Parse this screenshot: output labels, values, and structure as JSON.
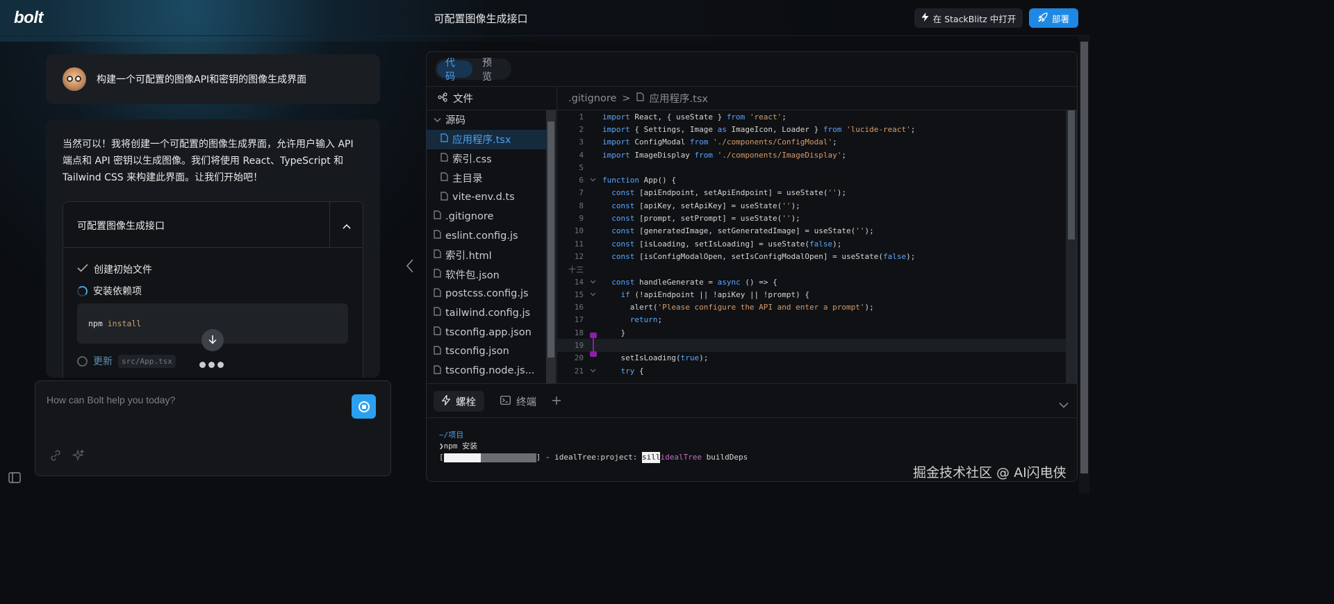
{
  "header": {
    "logo": "bolt",
    "title": "可配置图像生成接口",
    "stackblitz_label": "在 StackBlitz 中打开",
    "deploy_label": "部署"
  },
  "chat": {
    "user_message": "构建一个可配置的图像API和密钥的图像生成界面",
    "ai_message": "当然可以！我将创建一个可配置的图像生成界面，允许用户输入 API 端点和 API 密钥以生成图像。我们将使用 React、TypeScript 和 Tailwind CSS 来构建此界面。让我们开始吧！",
    "artifact": {
      "title": "可配置图像生成接口",
      "steps": [
        {
          "label": "创建初始文件",
          "status": "done"
        },
        {
          "label": "安装依赖项",
          "status": "running"
        },
        {
          "label": "更新",
          "chip": "src/App.tsx",
          "status": "pending"
        }
      ],
      "command": {
        "cmd": "npm",
        "arg": "install"
      }
    }
  },
  "prompt": {
    "placeholder": "How can Bolt help you today?"
  },
  "workbench": {
    "tabs": [
      "代码",
      "预览"
    ],
    "active_tab": "代码",
    "files_label": "文件",
    "tree": [
      {
        "name": "源码",
        "type": "folder",
        "depth": 0
      },
      {
        "name": "应用程序.tsx",
        "type": "file",
        "depth": 1,
        "selected": true
      },
      {
        "name": "索引.css",
        "type": "file",
        "depth": 1
      },
      {
        "name": "主目录",
        "type": "file",
        "depth": 1
      },
      {
        "name": "vite-env.d.ts",
        "type": "file",
        "depth": 1
      },
      {
        "name": ".gitignore",
        "type": "file",
        "depth": 0
      },
      {
        "name": "eslint.config.js",
        "type": "file",
        "depth": 0
      },
      {
        "name": "索引.html",
        "type": "file",
        "depth": 0
      },
      {
        "name": "软件包.json",
        "type": "file",
        "depth": 0
      },
      {
        "name": "postcss.config.js",
        "type": "file",
        "depth": 0
      },
      {
        "name": "tailwind.config.js",
        "type": "file",
        "depth": 0
      },
      {
        "name": "tsconfig.app.json",
        "type": "file",
        "depth": 0
      },
      {
        "name": "tsconfig.json",
        "type": "file",
        "depth": 0
      },
      {
        "name": "tsconfig.node.js...",
        "type": "file",
        "depth": 0
      }
    ],
    "breadcrumb": [
      ".gitignore",
      "应用程序.tsx"
    ],
    "code_lines": [
      {
        "n": "1",
        "fold": "",
        "tokens": [
          [
            "kw",
            "import "
          ],
          [
            "id",
            "React, { useState } "
          ],
          [
            "kw",
            "from "
          ],
          [
            "st",
            "'react'"
          ],
          [
            "id",
            ";"
          ]
        ]
      },
      {
        "n": "2",
        "fold": "",
        "tokens": [
          [
            "kw",
            "import "
          ],
          [
            "id",
            "{ Settings, Image "
          ],
          [
            "kw",
            "as "
          ],
          [
            "id",
            "ImageIcon, Loader } "
          ],
          [
            "kw",
            "from "
          ],
          [
            "st",
            "'lucide-react'"
          ],
          [
            "id",
            ";"
          ]
        ]
      },
      {
        "n": "3",
        "fold": "",
        "tokens": [
          [
            "kw",
            "import "
          ],
          [
            "id",
            "ConfigModal "
          ],
          [
            "kw",
            "from "
          ],
          [
            "st",
            "'./components/ConfigModal'"
          ],
          [
            "id",
            ";"
          ]
        ]
      },
      {
        "n": "4",
        "fold": "",
        "tokens": [
          [
            "kw",
            "import "
          ],
          [
            "id",
            "ImageDisplay "
          ],
          [
            "kw",
            "from "
          ],
          [
            "st",
            "'./components/ImageDisplay'"
          ],
          [
            "id",
            ";"
          ]
        ]
      },
      {
        "n": "5",
        "fold": "",
        "tokens": []
      },
      {
        "n": "6",
        "fold": "v",
        "tokens": [
          [
            "kw",
            "function "
          ],
          [
            "id",
            "App() {"
          ]
        ]
      },
      {
        "n": "7",
        "fold": "",
        "tokens": [
          [
            "id",
            "  "
          ],
          [
            "kw",
            "const "
          ],
          [
            "id",
            "[apiEndpoint, setApiEndpoint] = useState("
          ],
          [
            "st",
            "''"
          ],
          [
            "id",
            ");"
          ]
        ]
      },
      {
        "n": "8",
        "fold": "",
        "tokens": [
          [
            "id",
            "  "
          ],
          [
            "kw",
            "const "
          ],
          [
            "id",
            "[apiKey, setApiKey] = useState("
          ],
          [
            "st",
            "''"
          ],
          [
            "id",
            ");"
          ]
        ]
      },
      {
        "n": "9",
        "fold": "",
        "tokens": [
          [
            "id",
            "  "
          ],
          [
            "kw",
            "const "
          ],
          [
            "id",
            "[prompt, setPrompt] = useState("
          ],
          [
            "st",
            "''"
          ],
          [
            "id",
            ");"
          ]
        ]
      },
      {
        "n": "10",
        "fold": "",
        "tokens": [
          [
            "id",
            "  "
          ],
          [
            "kw",
            "const "
          ],
          [
            "id",
            "[generatedImage, setGeneratedImage] = useState("
          ],
          [
            "st",
            "''"
          ],
          [
            "id",
            ");"
          ]
        ]
      },
      {
        "n": "11",
        "fold": "",
        "tokens": [
          [
            "id",
            "  "
          ],
          [
            "kw",
            "const "
          ],
          [
            "id",
            "[isLoading, setIsLoading] = useState("
          ],
          [
            "kw",
            "false"
          ],
          [
            "id",
            ");"
          ]
        ]
      },
      {
        "n": "12",
        "fold": "",
        "tokens": [
          [
            "id",
            "  "
          ],
          [
            "kw",
            "const "
          ],
          [
            "id",
            "[isConfigModalOpen, setIsConfigModalOpen] = useState("
          ],
          [
            "kw",
            "false"
          ],
          [
            "id",
            ");"
          ]
        ]
      },
      {
        "n": "十三",
        "fold": "",
        "tokens": []
      },
      {
        "n": "14",
        "fold": "v",
        "tokens": [
          [
            "id",
            "  "
          ],
          [
            "kw",
            "const "
          ],
          [
            "id",
            "handleGenerate = "
          ],
          [
            "kw",
            "async "
          ],
          [
            "id",
            "() => {"
          ]
        ]
      },
      {
        "n": "15",
        "fold": "v",
        "tokens": [
          [
            "id",
            "    "
          ],
          [
            "kw",
            "if "
          ],
          [
            "id",
            "(!apiEndpoint || !apiKey || !prompt) {"
          ]
        ]
      },
      {
        "n": "16",
        "fold": "",
        "tokens": [
          [
            "id",
            "      alert("
          ],
          [
            "st",
            "'Please configure the API and enter a prompt'"
          ],
          [
            "id",
            ");"
          ]
        ]
      },
      {
        "n": "17",
        "fold": "",
        "tokens": [
          [
            "id",
            "      "
          ],
          [
            "kw",
            "return"
          ],
          [
            "id",
            ";"
          ]
        ]
      },
      {
        "n": "18",
        "fold": "",
        "tokens": [
          [
            "id",
            "    }"
          ]
        ]
      },
      {
        "n": "19",
        "fold": "",
        "tokens": [],
        "highlight": true
      },
      {
        "n": "20",
        "fold": "",
        "tokens": [
          [
            "id",
            "    setIsLoading("
          ],
          [
            "kw",
            "true"
          ],
          [
            "id",
            ");"
          ]
        ]
      },
      {
        "n": "21",
        "fold": "v",
        "tokens": [
          [
            "id",
            "    "
          ],
          [
            "kw",
            "try "
          ],
          [
            "id",
            "{"
          ]
        ]
      }
    ],
    "terminal_tabs": [
      "螺栓",
      "终端"
    ],
    "terminal_lines": [
      {
        "text": "~/项目",
        "color": "#4aa3f0"
      },
      {
        "text": "❯npm 安装",
        "color": "#e6e6e6"
      },
      {
        "text": "] - idealTree:project: ",
        "color": "#e6e6e6",
        "badge": "sill",
        "tail1": "idealTree",
        "tail2": " buildDeps"
      }
    ],
    "progress": 0.4
  },
  "watermark": "掘金技术社区 @ AI闪电侠",
  "colors": {
    "accent": "#1e88e5",
    "keyword": "#5aa7ff",
    "string": "#d99b6a"
  }
}
